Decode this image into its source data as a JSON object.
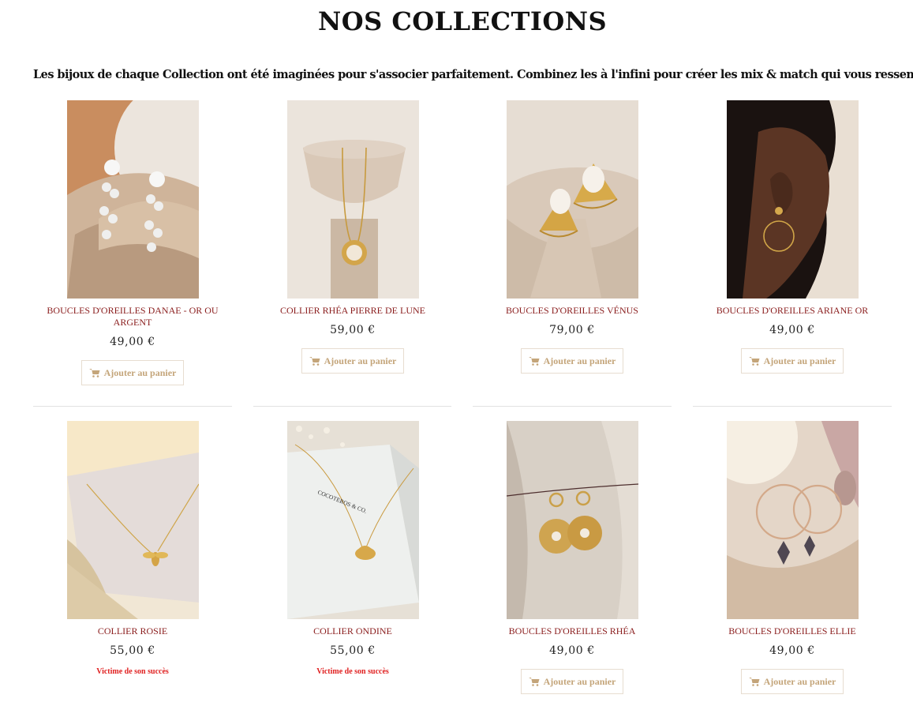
{
  "page": {
    "title": "NOS COLLECTIONS",
    "intro": "Les bijoux de chaque Collection ont été imaginées pour s'associer parfaitement. Combinez les à l'infini pour créer les mix & match qui vous ressemblent."
  },
  "products": [
    {
      "name": "BOUCLES D'OREILLES DANAE - OR OU ARGENT",
      "price": "49,00 €",
      "button": "Ajouter au panier",
      "status": ""
    },
    {
      "name": "COLLIER RHÉA PIERRE DE LUNE",
      "price": "59,00 €",
      "button": "Ajouter au panier",
      "status": ""
    },
    {
      "name": "BOUCLES D'OREILLES VÉNUS",
      "price": "79,00 €",
      "button": "Ajouter au panier",
      "status": ""
    },
    {
      "name": "BOUCLES D'OREILLES ARIANE OR",
      "price": "49,00 €",
      "button": "Ajouter au panier",
      "status": ""
    },
    {
      "name": "COLLIER ROSIE",
      "price": "55,00 €",
      "button": "",
      "status": "Victime de son succès"
    },
    {
      "name": "COLLIER ONDINE",
      "price": "55,00 €",
      "button": "",
      "status": "Victime de son succès"
    },
    {
      "name": "BOUCLES D'OREILLES RHÉA",
      "price": "49,00 €",
      "button": "Ajouter au panier",
      "status": ""
    },
    {
      "name": "BOUCLES D'OREILLES ELLIE",
      "price": "49,00 €",
      "button": "Ajouter au panier",
      "status": ""
    }
  ],
  "box_text": "COCOTEROS & CO.",
  "colors": {
    "product_name": "#8a1d1d",
    "button_text": "#c4a57a",
    "soldout": "#e02020"
  },
  "icons": {
    "cart": "shopping-cart-icon"
  }
}
